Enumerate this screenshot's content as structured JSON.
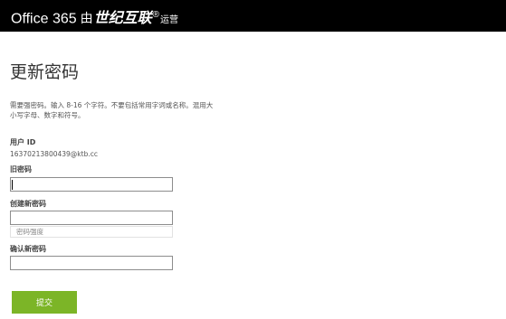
{
  "header": {
    "product": "Office 365",
    "by": "由",
    "partner": "世纪互联",
    "partner_mark": "®",
    "operated": "运营",
    "colors": {
      "bar": "#000000",
      "text": "#ffffff"
    }
  },
  "page": {
    "title": "更新密码",
    "description": "需要强密码。输入 8-16 个字符。不要包括常用字词或名称。混用大小写字母、数字和符号。"
  },
  "user": {
    "label": "用户 ID",
    "value": "16370213800439@ktb.cc"
  },
  "fields": {
    "old_password": {
      "label": "旧密码",
      "value": ""
    },
    "new_password": {
      "label": "创建新密码",
      "value": "",
      "strength_label": "密码强度"
    },
    "confirm_password": {
      "label": "确认新密码",
      "value": ""
    }
  },
  "actions": {
    "submit_label": "提交",
    "submit_color": "#7cb527"
  }
}
